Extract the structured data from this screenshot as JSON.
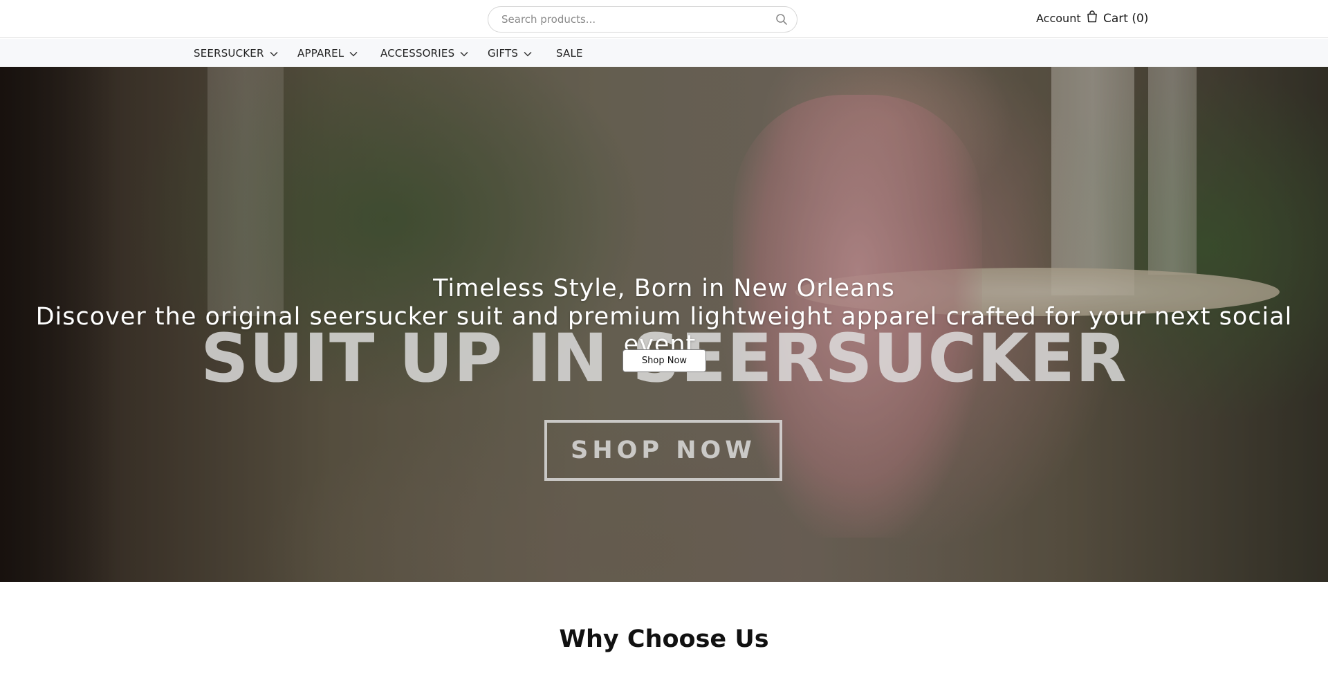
{
  "header": {
    "search": {
      "placeholder": "Search products...",
      "icon": "search-icon"
    },
    "account_label": "Account",
    "cart_label": "Cart (0)",
    "cart_icon": "shopping-bag-icon"
  },
  "nav": {
    "items": [
      {
        "label": "SEERSUCKER",
        "has_dropdown": true
      },
      {
        "label": "APPAREL",
        "has_dropdown": true
      },
      {
        "label": "ACCESSORIES",
        "has_dropdown": true
      },
      {
        "label": "GIFTS",
        "has_dropdown": true
      },
      {
        "label": "SALE",
        "has_dropdown": false
      }
    ]
  },
  "hero": {
    "title": "Timeless Style, Born in New Orleans",
    "subtitle": "Discover the original seersucker suit and premium lightweight apparel crafted for your next social event.",
    "button_label": "Shop Now",
    "image_headline": "SUIT UP IN SEERSUCKER",
    "image_button": "SHOP NOW"
  },
  "sections": {
    "why_heading": "Why Choose Us"
  }
}
